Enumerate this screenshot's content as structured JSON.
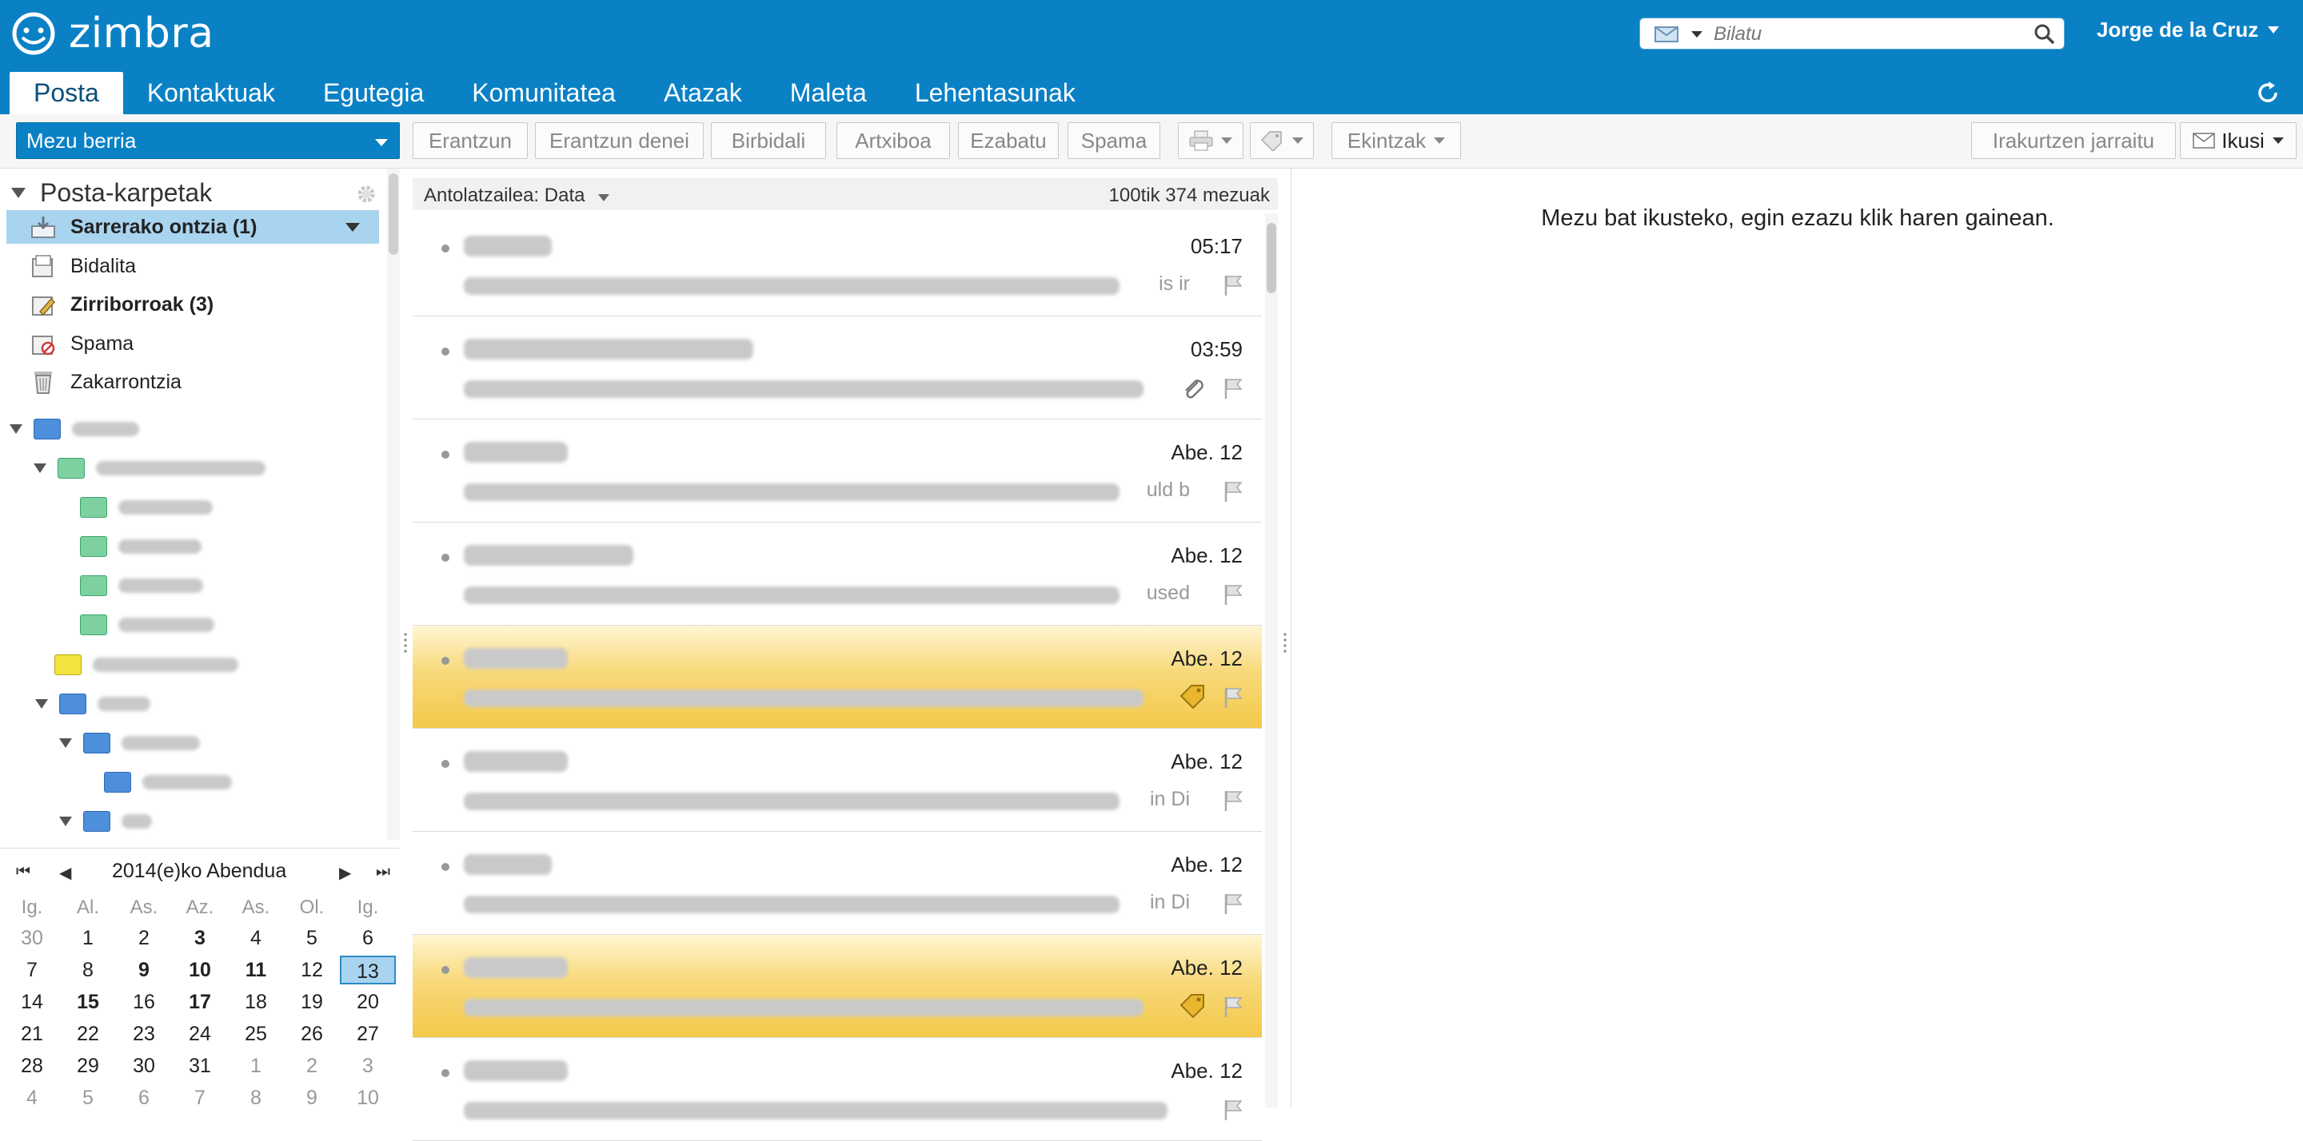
{
  "app": {
    "name": "zimbra"
  },
  "search": {
    "placeholder": "Bilatu"
  },
  "user": {
    "name": "Jorge de la Cruz"
  },
  "tabs": [
    {
      "label": "Posta",
      "active": true
    },
    {
      "label": "Kontaktuak"
    },
    {
      "label": "Egutegia"
    },
    {
      "label": "Komunitatea"
    },
    {
      "label": "Atazak"
    },
    {
      "label": "Maleta"
    },
    {
      "label": "Lehentasunak"
    }
  ],
  "toolbar": {
    "new_message": "Mezu berria",
    "reply": "Erantzun",
    "reply_all": "Erantzun denei",
    "forward": "Birbidali",
    "archive": "Artxiboa",
    "delete": "Ezabatu",
    "spam": "Spama",
    "actions": "Ekintzak",
    "continue_reading": "Irakurtzen jarraitu",
    "view": "Ikusi"
  },
  "folders": {
    "header": "Posta-karpetak",
    "system": [
      {
        "label": "Sarrerako ontzia (1)",
        "icon": "inbox-icon",
        "bold": true,
        "selected": true
      },
      {
        "label": "Bidalita",
        "icon": "sent-icon"
      },
      {
        "label": "Zirriborroak (3)",
        "icon": "drafts-icon",
        "bold": true
      },
      {
        "label": "Spama",
        "icon": "spam-icon"
      },
      {
        "label": "Zakarrontzia",
        "icon": "trash-icon"
      }
    ]
  },
  "calendar": {
    "title": "2014(e)ko Abendua",
    "weekdays": [
      "Ig.",
      "Al.",
      "As.",
      "Az.",
      "As.",
      "Ol.",
      "Ig."
    ],
    "days": [
      [
        "30",
        "1",
        "2",
        "3",
        "4",
        "5",
        "6"
      ],
      [
        "7",
        "8",
        "9",
        "10",
        "11",
        "12",
        "13"
      ],
      [
        "14",
        "15",
        "16",
        "17",
        "18",
        "19",
        "20"
      ],
      [
        "21",
        "22",
        "23",
        "24",
        "25",
        "26",
        "27"
      ],
      [
        "28",
        "29",
        "30",
        "31",
        "1",
        "2",
        "3"
      ],
      [
        "4",
        "5",
        "6",
        "7",
        "8",
        "9",
        "10"
      ]
    ],
    "today": "13"
  },
  "list": {
    "sort_label": "Antolatzailea: Data",
    "count_label": "100tik 374 mezuak",
    "messages": [
      {
        "date": "05:17",
        "tail": "is ir"
      },
      {
        "date": "03:59",
        "tail": ""
      },
      {
        "date": "Abe. 12",
        "tail": "uld b"
      },
      {
        "date": "Abe. 12",
        "tail": "used"
      },
      {
        "date": "Abe. 12",
        "tail": ""
      },
      {
        "date": "Abe. 12",
        "tail": "in Di"
      },
      {
        "date": "Abe. 12",
        "tail": "in Di"
      },
      {
        "date": "Abe. 12",
        "tail": ""
      },
      {
        "date": "Abe. 12",
        "tail": ""
      }
    ]
  },
  "reading_pane": {
    "message": "Mezu bat ikusteko, egin ezazu klik haren gainean."
  }
}
